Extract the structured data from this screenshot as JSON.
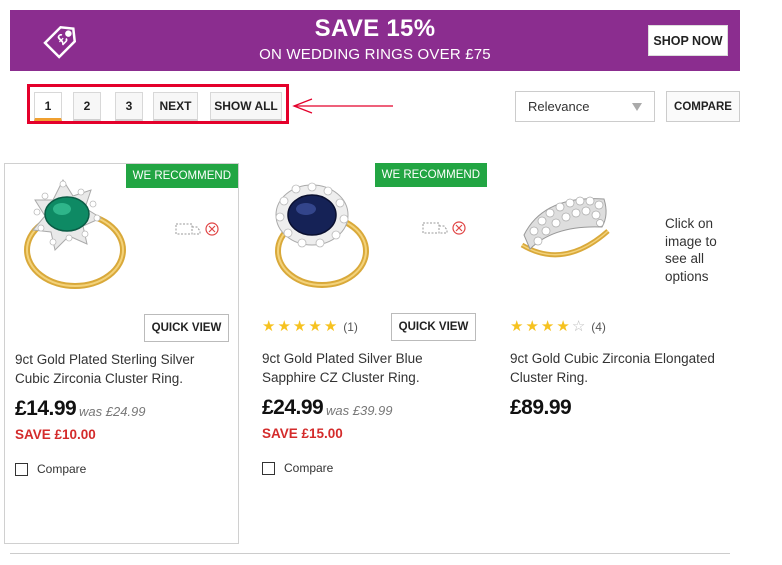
{
  "banner": {
    "headline": "SAVE 15%",
    "subline": "ON WEDDING RINGS OVER £75",
    "cta": "SHOP NOW",
    "icon": "price-tag-pound-icon",
    "bg_color": "#8b2d8f"
  },
  "pagination": {
    "pages": [
      "1",
      "2",
      "3"
    ],
    "active_page": "1",
    "next": "NEXT",
    "show_all": "SHOW ALL",
    "highlight_color": "#e4002b"
  },
  "sort": {
    "selected": "Relevance"
  },
  "compare_button": "COMPARE",
  "products": [
    {
      "badge": "WE RECOMMEND",
      "title": "9ct Gold Plated Sterling Silver Cubic Zirconia Cluster Ring.",
      "price": "£14.99",
      "was": "was £24.99",
      "save": "SAVE £10.00",
      "quick_view": "QUICK VIEW",
      "compare": "Compare",
      "stone": "emerald"
    },
    {
      "badge": "WE RECOMMEND",
      "title": "9ct Gold Plated Silver Blue Sapphire CZ Cluster Ring.",
      "price": "£24.99",
      "was": "was £39.99",
      "save": "SAVE £15.00",
      "quick_view": "QUICK VIEW",
      "compare": "Compare",
      "rating": 5,
      "reviews": "(1)",
      "stone": "sapphire"
    },
    {
      "title": "9ct Gold Cubic Zirconia Elongated Cluster Ring.",
      "price": "£89.99",
      "rating": 4,
      "reviews": "(4)",
      "note": "Click on image to see all options",
      "stone": "cubic-zirconia"
    }
  ],
  "colors": {
    "recommend_badge": "#22a543",
    "save_text": "#d42b2b",
    "star": "#f6c220"
  }
}
